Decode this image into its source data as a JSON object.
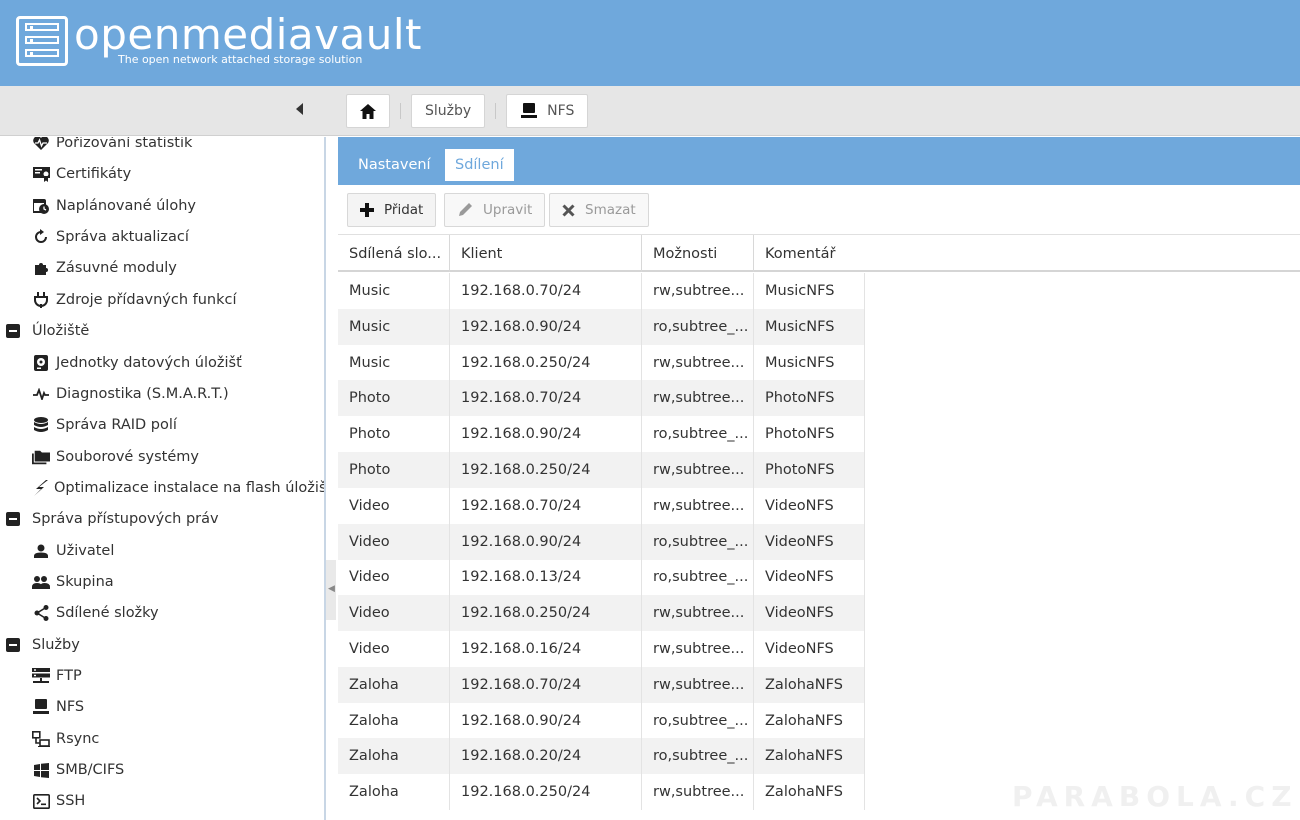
{
  "header": {
    "brand": "openmediavault",
    "tagline": "The open network attached storage solution"
  },
  "breadcrumb": {
    "items": [
      {
        "label": "Služby"
      },
      {
        "label": "NFS"
      }
    ]
  },
  "sidebar": {
    "items": [
      {
        "label": "Pořizování statistik",
        "icon": "heart-pulse-icon",
        "type": "child"
      },
      {
        "label": "Certifikáty",
        "icon": "certificate-icon",
        "type": "child"
      },
      {
        "label": "Naplánované úlohy",
        "icon": "calendar-clock-icon",
        "type": "child"
      },
      {
        "label": "Správa aktualizací",
        "icon": "update-icon",
        "type": "child"
      },
      {
        "label": "Zásuvné moduly",
        "icon": "puzzle-icon",
        "type": "child"
      },
      {
        "label": "Zdroje přídavných funkcí",
        "icon": "plug-icon",
        "type": "child"
      },
      {
        "label": "Úložiště",
        "icon": "collapse-icon",
        "type": "group"
      },
      {
        "label": "Jednotky datových úložišť",
        "icon": "harddisk-icon",
        "type": "child"
      },
      {
        "label": "Diagnostika (S.M.A.R.T.)",
        "icon": "pulse-icon",
        "type": "child"
      },
      {
        "label": "Správa RAID polí",
        "icon": "database-icon",
        "type": "child"
      },
      {
        "label": "Souborové systémy",
        "icon": "folders-icon",
        "type": "child"
      },
      {
        "label": "Optimalizace instalace na flash úložiště",
        "icon": "flash-icon",
        "type": "child"
      },
      {
        "label": "Správa přístupových práv",
        "icon": "collapse-icon",
        "type": "group"
      },
      {
        "label": "Uživatel",
        "icon": "user-icon",
        "type": "child"
      },
      {
        "label": "Skupina",
        "icon": "group-icon",
        "type": "child"
      },
      {
        "label": "Sdílené složky",
        "icon": "share-icon",
        "type": "child"
      },
      {
        "label": "Služby",
        "icon": "collapse-icon",
        "type": "group"
      },
      {
        "label": "FTP",
        "icon": "server-icon",
        "type": "child"
      },
      {
        "label": "NFS",
        "icon": "desktop-icon",
        "type": "child"
      },
      {
        "label": "Rsync",
        "icon": "network-icon",
        "type": "child"
      },
      {
        "label": "SMB/CIFS",
        "icon": "windows-icon",
        "type": "child"
      },
      {
        "label": "SSH",
        "icon": "terminal-icon",
        "type": "child"
      }
    ]
  },
  "tabs": [
    {
      "label": "Nastavení",
      "active": false
    },
    {
      "label": "Sdílení",
      "active": true
    }
  ],
  "actions": {
    "add": "Přidat",
    "edit": "Upravit",
    "delete": "Smazat"
  },
  "table": {
    "columns": [
      "Sdílená slo...",
      "Klient",
      "Možnosti",
      "Komentář"
    ],
    "rows": [
      [
        "Music",
        "192.168.0.70/24",
        "rw,subtree...",
        "MusicNFS"
      ],
      [
        "Music",
        "192.168.0.90/24",
        "ro,subtree_...",
        "MusicNFS"
      ],
      [
        "Music",
        "192.168.0.250/24",
        "rw,subtree...",
        "MusicNFS"
      ],
      [
        "Photo",
        "192.168.0.70/24",
        "rw,subtree...",
        "PhotoNFS"
      ],
      [
        "Photo",
        "192.168.0.90/24",
        "ro,subtree_...",
        "PhotoNFS"
      ],
      [
        "Photo",
        "192.168.0.250/24",
        "rw,subtree...",
        "PhotoNFS"
      ],
      [
        "Video",
        "192.168.0.70/24",
        "rw,subtree...",
        "VideoNFS"
      ],
      [
        "Video",
        "192.168.0.90/24",
        "ro,subtree_...",
        "VideoNFS"
      ],
      [
        "Video",
        "192.168.0.13/24",
        "ro,subtree_...",
        "VideoNFS"
      ],
      [
        "Video",
        "192.168.0.250/24",
        "rw,subtree...",
        "VideoNFS"
      ],
      [
        "Video",
        "192.168.0.16/24",
        "rw,subtree...",
        "VideoNFS"
      ],
      [
        "Zaloha",
        "192.168.0.70/24",
        "rw,subtree...",
        "ZalohaNFS"
      ],
      [
        "Zaloha",
        "192.168.0.90/24",
        "ro,subtree_...",
        "ZalohaNFS"
      ],
      [
        "Zaloha",
        "192.168.0.20/24",
        "ro,subtree_...",
        "ZalohaNFS"
      ],
      [
        "Zaloha",
        "192.168.0.250/24",
        "rw,subtree...",
        "ZalohaNFS"
      ]
    ]
  },
  "watermark": "PARABOLA.CZ",
  "colors": {
    "header": "#6fa8dc",
    "tabbar": "#6fa8dc",
    "row_alt": "#f2f2f2"
  }
}
